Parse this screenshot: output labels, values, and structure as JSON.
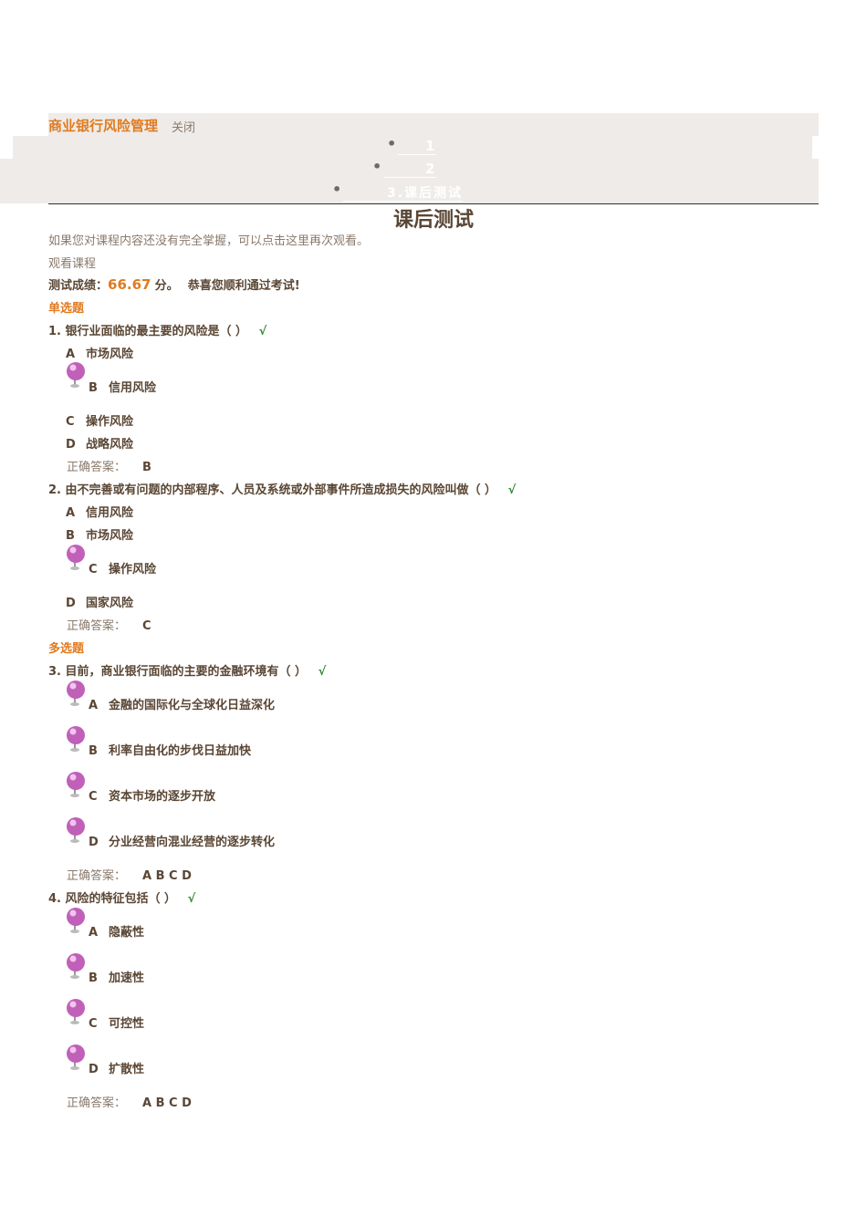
{
  "header": {
    "course_title": "商业银行风险管理",
    "close_link": "关闭",
    "nav": [
      "1",
      "2",
      "3.课后测试"
    ]
  },
  "page_title": "课后测试",
  "review_hint": "如果您对课程内容还没有完全掌握，可以点击这里再次观看。",
  "view_course": "观看课程",
  "score": {
    "label": "测试成绩：",
    "value": "66.67",
    "unit": "分。",
    "message": "恭喜您顺利通过考试!"
  },
  "sections": {
    "single": "单选题",
    "multi": "多选题"
  },
  "answer_label": "正确答案：",
  "check_mark": "√",
  "questions": [
    {
      "number": "1.",
      "text": "银行业面临的最主要的风险是（ ）",
      "options": [
        {
          "letter": "A",
          "text": "市场风险"
        },
        {
          "letter": "B",
          "text": "信用风险"
        },
        {
          "letter": "C",
          "text": "操作风险"
        },
        {
          "letter": "D",
          "text": "战略风险"
        }
      ],
      "answer": "B"
    },
    {
      "number": "2.",
      "text": "由不完善或有问题的内部程序、人员及系统或外部事件所造成损失的风险叫做（ ）",
      "options": [
        {
          "letter": "A",
          "text": "信用风险"
        },
        {
          "letter": "B",
          "text": "市场风险"
        },
        {
          "letter": "C",
          "text": "操作风险"
        },
        {
          "letter": "D",
          "text": "国家风险"
        }
      ],
      "answer": "C"
    },
    {
      "number": "3.",
      "text": "目前，商业银行面临的主要的金融环境有（ ）",
      "options": [
        {
          "letter": "A",
          "text": "金融的国际化与全球化日益深化"
        },
        {
          "letter": "B",
          "text": "利率自由化的步伐日益加快"
        },
        {
          "letter": "C",
          "text": "资本市场的逐步开放"
        },
        {
          "letter": "D",
          "text": "分业经营向混业经营的逐步转化"
        }
      ],
      "answer": "A B C D"
    },
    {
      "number": "4.",
      "text": "风险的特征包括（ ）",
      "options": [
        {
          "letter": "A",
          "text": "隐蔽性"
        },
        {
          "letter": "B",
          "text": "加速性"
        },
        {
          "letter": "C",
          "text": "可控性"
        },
        {
          "letter": "D",
          "text": "扩散性"
        }
      ],
      "answer": "A B C D"
    }
  ],
  "colors": {
    "accent": "#e07b21",
    "text": "#5a4634",
    "muted": "#8a7a6c",
    "band": "#efebe8",
    "check": "#2e8b2e",
    "pin": "#c060b8"
  },
  "icons": {
    "selected_pin": "pushpin-icon",
    "correct": "checkmark-icon"
  }
}
